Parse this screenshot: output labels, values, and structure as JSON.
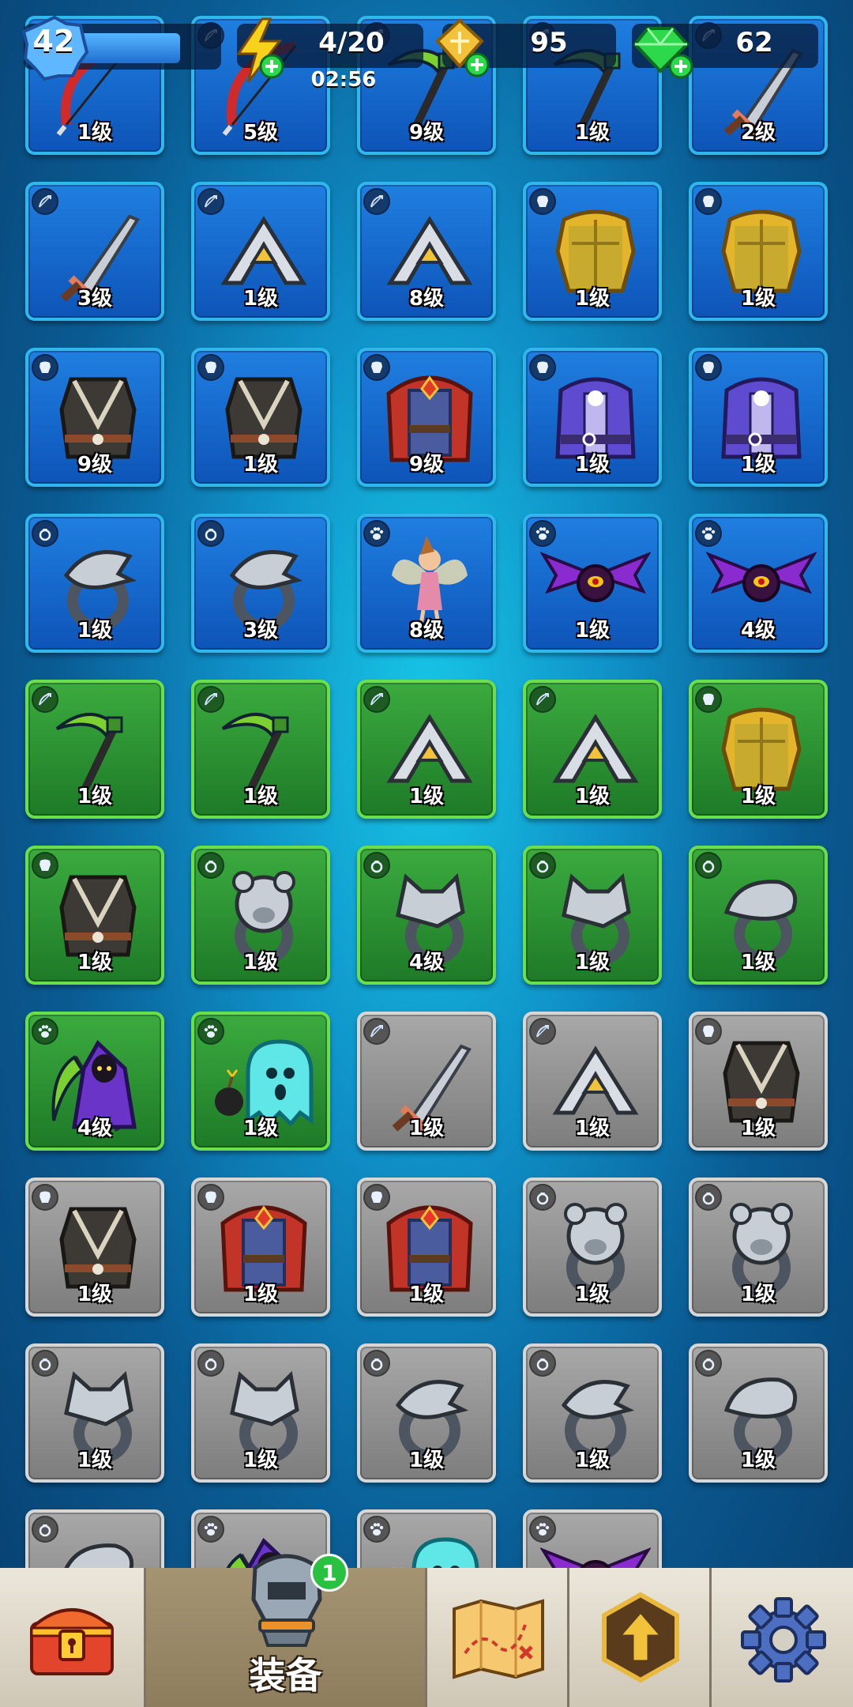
{
  "hud": {
    "player_level": "42",
    "energy": "4/20",
    "energy_timer": "02:56",
    "gold": "95",
    "gems": "62",
    "colors": {
      "xp_bar": "#3a9ae8",
      "energy": "#f5d21e",
      "gem": "#2bd94b"
    }
  },
  "inventory": {
    "items": [
      {
        "slot": "weapon",
        "art": "bow",
        "rarity": "blue",
        "level": "1级"
      },
      {
        "slot": "weapon",
        "art": "bow",
        "rarity": "blue",
        "level": "5级"
      },
      {
        "slot": "weapon",
        "art": "scythe",
        "rarity": "blue",
        "level": "9级"
      },
      {
        "slot": "weapon",
        "art": "scythe",
        "rarity": "blue",
        "level": "1级"
      },
      {
        "slot": "weapon",
        "art": "sword",
        "rarity": "blue",
        "level": "2级"
      },
      {
        "slot": "weapon",
        "art": "sword",
        "rarity": "blue",
        "level": "3级"
      },
      {
        "slot": "weapon",
        "art": "boomerang",
        "rarity": "blue",
        "level": "1级"
      },
      {
        "slot": "weapon",
        "art": "boomerang",
        "rarity": "blue",
        "level": "8级"
      },
      {
        "slot": "armor",
        "art": "gold-armor",
        "rarity": "blue",
        "level": "1级"
      },
      {
        "slot": "armor",
        "art": "gold-armor",
        "rarity": "blue",
        "level": "1级"
      },
      {
        "slot": "armor",
        "art": "dark-vest",
        "rarity": "blue",
        "level": "9级"
      },
      {
        "slot": "armor",
        "art": "dark-vest",
        "rarity": "blue",
        "level": "1级"
      },
      {
        "slot": "armor",
        "art": "red-robe",
        "rarity": "blue",
        "level": "9级"
      },
      {
        "slot": "armor",
        "art": "purple-robe",
        "rarity": "blue",
        "level": "1级"
      },
      {
        "slot": "armor",
        "art": "purple-robe",
        "rarity": "blue",
        "level": "1级"
      },
      {
        "slot": "ring",
        "art": "eagle-ring",
        "rarity": "blue",
        "level": "1级"
      },
      {
        "slot": "ring",
        "art": "eagle-ring",
        "rarity": "blue",
        "level": "3级"
      },
      {
        "slot": "pet",
        "art": "fairy",
        "rarity": "blue",
        "level": "8级"
      },
      {
        "slot": "pet",
        "art": "bat",
        "rarity": "blue",
        "level": "1级"
      },
      {
        "slot": "pet",
        "art": "bat",
        "rarity": "blue",
        "level": "4级"
      },
      {
        "slot": "weapon",
        "art": "scythe",
        "rarity": "green",
        "level": "1级"
      },
      {
        "slot": "weapon",
        "art": "scythe",
        "rarity": "green",
        "level": "1级"
      },
      {
        "slot": "weapon",
        "art": "boomerang",
        "rarity": "green",
        "level": "1级"
      },
      {
        "slot": "weapon",
        "art": "boomerang",
        "rarity": "green",
        "level": "1级"
      },
      {
        "slot": "armor",
        "art": "gold-armor",
        "rarity": "green",
        "level": "1级"
      },
      {
        "slot": "armor",
        "art": "dark-vest",
        "rarity": "green",
        "level": "1级"
      },
      {
        "slot": "ring",
        "art": "bear-ring",
        "rarity": "green",
        "level": "1级"
      },
      {
        "slot": "ring",
        "art": "wolf-ring",
        "rarity": "green",
        "level": "4级"
      },
      {
        "slot": "ring",
        "art": "wolf-ring",
        "rarity": "green",
        "level": "1级"
      },
      {
        "slot": "ring",
        "art": "snake-ring",
        "rarity": "green",
        "level": "1级"
      },
      {
        "slot": "pet",
        "art": "reaper",
        "rarity": "green",
        "level": "4级"
      },
      {
        "slot": "pet",
        "art": "ghost",
        "rarity": "green",
        "level": "1级"
      },
      {
        "slot": "weapon",
        "art": "sword",
        "rarity": "gray",
        "level": "1级"
      },
      {
        "slot": "weapon",
        "art": "boomerang",
        "rarity": "gray",
        "level": "1级"
      },
      {
        "slot": "armor",
        "art": "dark-vest",
        "rarity": "gray",
        "level": "1级"
      },
      {
        "slot": "armor",
        "art": "dark-vest",
        "rarity": "gray",
        "level": "1级"
      },
      {
        "slot": "armor",
        "art": "red-robe",
        "rarity": "gray",
        "level": "1级"
      },
      {
        "slot": "armor",
        "art": "red-robe",
        "rarity": "gray",
        "level": "1级"
      },
      {
        "slot": "ring",
        "art": "bear-ring",
        "rarity": "gray",
        "level": "1级"
      },
      {
        "slot": "ring",
        "art": "bear-ring",
        "rarity": "gray",
        "level": "1级"
      },
      {
        "slot": "ring",
        "art": "wolf-ring",
        "rarity": "gray",
        "level": "1级"
      },
      {
        "slot": "ring",
        "art": "wolf-ring",
        "rarity": "gray",
        "level": "1级"
      },
      {
        "slot": "ring",
        "art": "eagle-ring",
        "rarity": "gray",
        "level": "1级"
      },
      {
        "slot": "ring",
        "art": "eagle-ring",
        "rarity": "gray",
        "level": "1级"
      },
      {
        "slot": "ring",
        "art": "snake-ring",
        "rarity": "gray",
        "level": "1级"
      },
      {
        "slot": "ring",
        "art": "snake-ring",
        "rarity": "gray",
        "level": ""
      },
      {
        "slot": "pet",
        "art": "reaper",
        "rarity": "gray",
        "level": ""
      },
      {
        "slot": "pet",
        "art": "ghost",
        "rarity": "gray",
        "level": ""
      },
      {
        "slot": "pet",
        "art": "bat",
        "rarity": "gray",
        "level": ""
      }
    ]
  },
  "nav": {
    "items": [
      {
        "id": "chest",
        "icon": "treasure-chest-icon"
      },
      {
        "id": "equipment",
        "icon": "armor-icon",
        "label": "装备",
        "badge": "1"
      },
      {
        "id": "map",
        "icon": "map-icon"
      },
      {
        "id": "upgrade",
        "icon": "upgrade-arrow-icon"
      },
      {
        "id": "settings",
        "icon": "gear-icon"
      }
    ]
  }
}
